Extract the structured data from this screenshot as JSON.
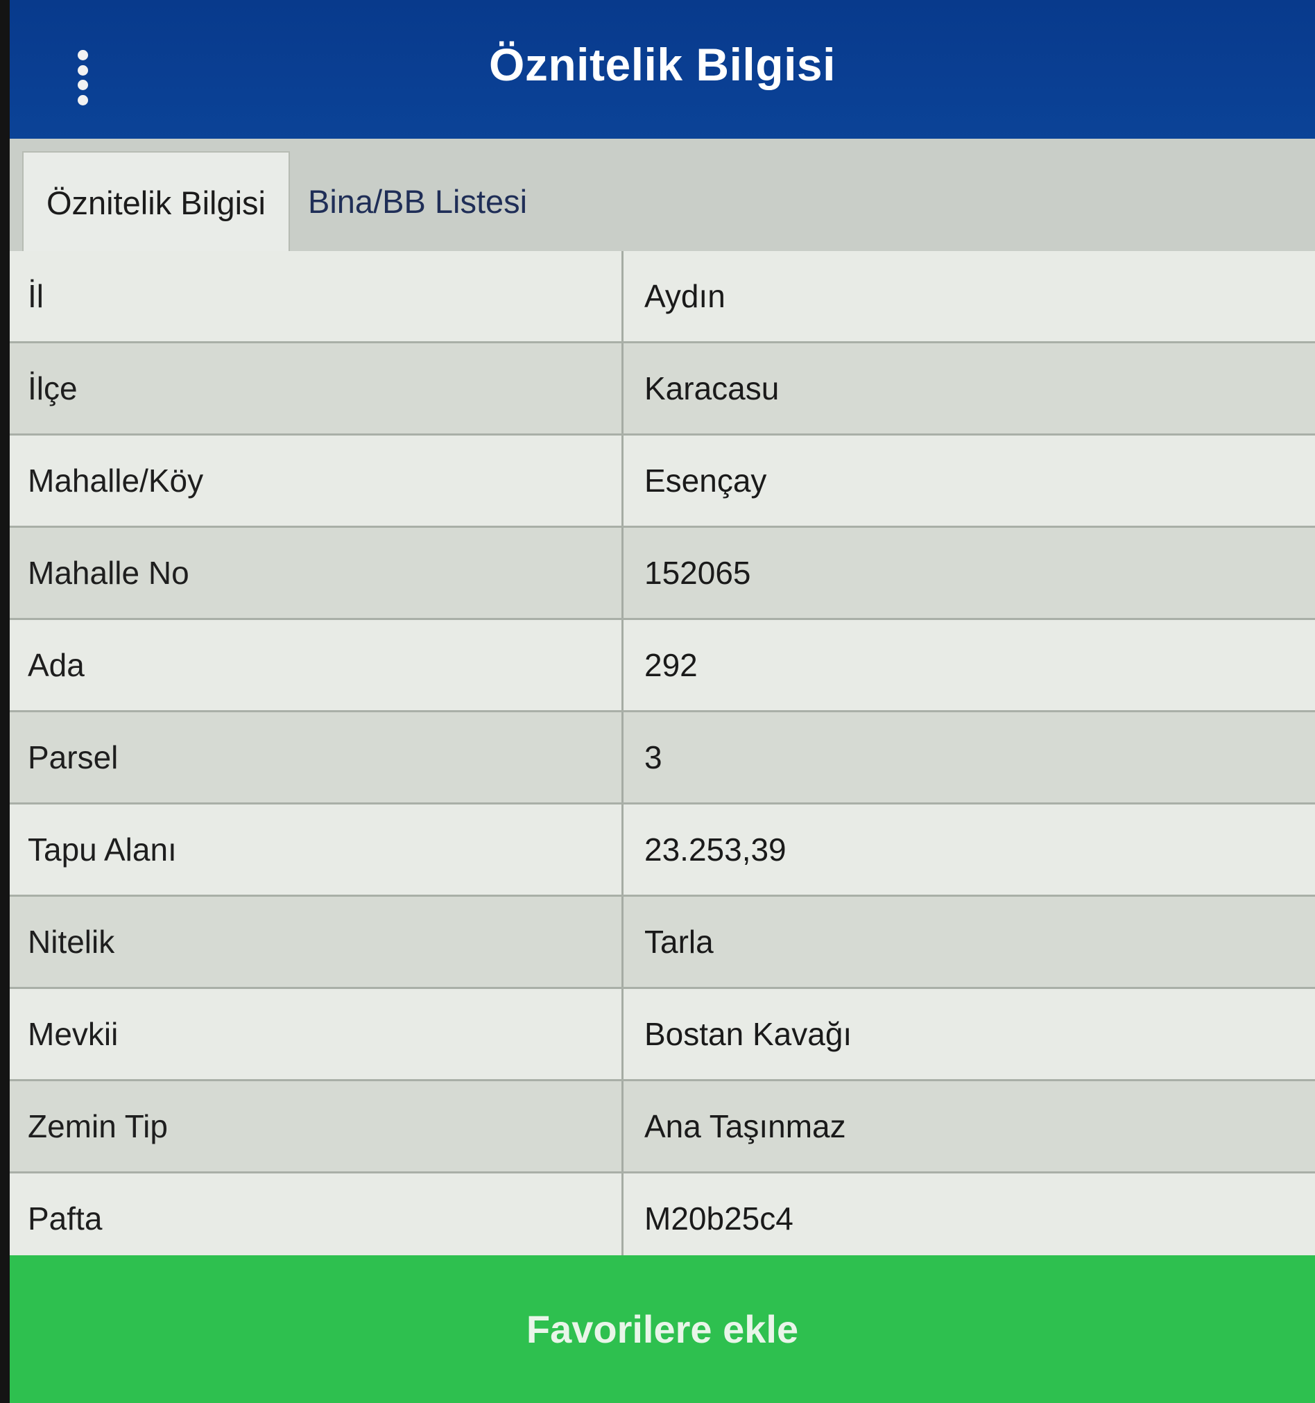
{
  "header": {
    "title": "Öznitelik Bilgisi",
    "menu_icon": "vertical-dots-icon"
  },
  "tabs": [
    {
      "label": "Öznitelik Bilgisi",
      "active": true
    },
    {
      "label": "Bina/BB Listesi",
      "active": false
    }
  ],
  "attributes": {
    "rows": [
      {
        "label": "İl",
        "value": "Aydın"
      },
      {
        "label": "İlçe",
        "value": "Karacasu"
      },
      {
        "label": "Mahalle/Köy",
        "value": "Esençay"
      },
      {
        "label": "Mahalle No",
        "value": "152065"
      },
      {
        "label": "Ada",
        "value": "292"
      },
      {
        "label": "Parsel",
        "value": "3"
      },
      {
        "label": "Tapu Alanı",
        "value": "23.253,39"
      },
      {
        "label": "Nitelik",
        "value": "Tarla"
      },
      {
        "label": "Mevkii",
        "value": "Bostan Kavağı"
      },
      {
        "label": "Zemin Tip",
        "value": "Ana Taşınmaz"
      },
      {
        "label": "Pafta",
        "value": "M20b25c4"
      }
    ]
  },
  "footer": {
    "favorite_label": "Favorilere ekle"
  },
  "colors": {
    "header_bg": "#0a3f93",
    "button_bg": "#2ec04f"
  }
}
